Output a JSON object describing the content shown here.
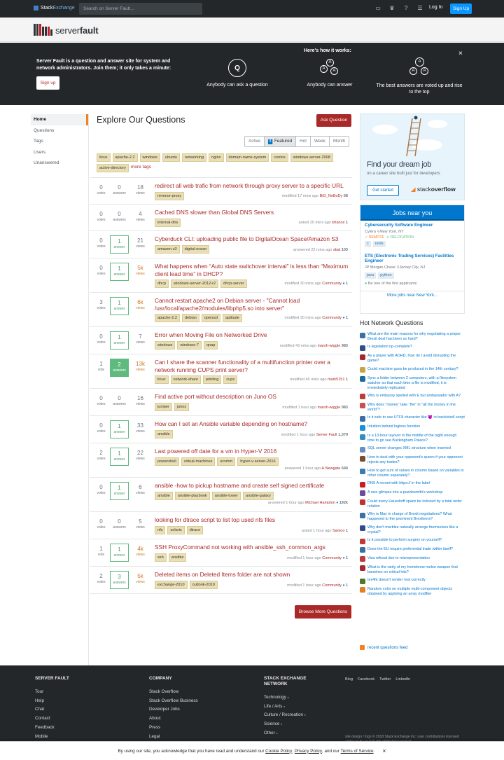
{
  "topbar": {
    "brand_stack": "Stack",
    "brand_exchange": "Exchange",
    "search_placeholder": "Search on Server Fault…",
    "login": "Log In",
    "signup": "Sign Up"
  },
  "site": {
    "name_light": "server",
    "name_bold": "fault"
  },
  "hero": {
    "text": "Server Fault is a question and answer site for system and network administrators. Join them; it only takes a minute:",
    "signup": "Sign up",
    "how": "Here's how it works:",
    "step1": "Anybody can ask a question",
    "step2": "Anybody can answer",
    "step3": "The best answers are voted up and rise to the top",
    "close": "×"
  },
  "nav": [
    "Home",
    "Questions",
    "Tags",
    "Users",
    "Unanswered"
  ],
  "main": {
    "title": "Explore Our Questions",
    "ask": "Ask Question",
    "filters": [
      "Active",
      "Featured",
      "Hot",
      "Week",
      "Month"
    ],
    "featured_count": "4",
    "tags": [
      "linux",
      "apache-2.2",
      "windows",
      "ubuntu",
      "networking",
      "nginx",
      "domain-name-system",
      "centos",
      "windows-server-2008",
      "active-directory"
    ],
    "more_tags": "more tags",
    "browse": "Browse More Questions"
  },
  "labels": {
    "votes": "votes",
    "vote": "vote",
    "answers": "answers",
    "answer": "answer",
    "views": "views"
  },
  "questions": [
    {
      "votes": "0",
      "vl": "votes",
      "answers": "0",
      "al": "answers",
      "views": "18",
      "title": "redirect all web trafic from network through proxy server to a specific URL",
      "tags": [
        "reverse-proxy"
      ],
      "meta_pre": "modified 17 mins ago",
      "user": "BiG_NoBoDy",
      "rep": "58",
      "h": 38
    },
    {
      "votes": "0",
      "vl": "votes",
      "answers": "0",
      "al": "answers",
      "views": "4",
      "title": "Cached DNS slower than Global DNS Servers",
      "tags": [
        "internal-dns"
      ],
      "meta_pre": "asked 20 mins ago",
      "user": "kfrance",
      "rep": "1",
      "h": 38
    },
    {
      "votes": "0",
      "vl": "votes",
      "answers": "1",
      "al": "answer",
      "views": "21",
      "title": "Cyberduck CLI: uploading public file to DigitalOcean Space/Amazon S3",
      "tags": [
        "amazon-s3",
        "digital-ocean"
      ],
      "meta_pre": "answered 22 mins ago",
      "user": "sbat",
      "rep": "103",
      "h": 39
    },
    {
      "votes": "0",
      "vl": "votes",
      "answers": "1",
      "al": "answer",
      "views": "5k",
      "title": "What happens when “Auto state switchover interval” is less than “Maximum client lead time” in DHCP?",
      "tags": [
        "dhcp",
        "windows-server-2012-r2",
        "dhcp-server"
      ],
      "meta_pre": "modified 30 mins ago",
      "user": "Community",
      "rep": "1",
      "diamond": true,
      "h": 49
    },
    {
      "votes": "3",
      "vl": "votes",
      "answers": "1",
      "al": "answer",
      "views": "6k",
      "title": "Cannot restart apache2 on Debian server - \"Cannot load /usr/local/apache2/modules/libphp5.so into server\"",
      "tags": [
        "apache-2.2",
        "debian",
        "openssl",
        "aptitude"
      ],
      "meta_pre": "modified 30 mins ago",
      "user": "Community",
      "rep": "1",
      "diamond": true,
      "h": 49
    },
    {
      "votes": "0",
      "vl": "votes",
      "answers": "1",
      "al": "answer",
      "views": "7",
      "title": "Error when Moving File on Networked Drive",
      "tags": [
        "windows",
        "windows-7",
        "qnap"
      ],
      "meta_pre": "modified 43 mins ago",
      "user": "marsh-wiggle",
      "rep": "983",
      "h": 39
    },
    {
      "votes": "1",
      "vl": "vote",
      "answers": "2",
      "al": "answers",
      "views": "13k",
      "title": "Can I share the scanner functionality of a multifunction printer over a network running CUPS print server?",
      "tags": [
        "linux",
        "network-share",
        "printing",
        "cups"
      ],
      "meta_pre": "modified 45 mins ago",
      "user": "mark5151",
      "rep": "1",
      "accepted": true,
      "h": 49
    },
    {
      "votes": "0",
      "vl": "votes",
      "answers": "0",
      "al": "answers",
      "views": "16",
      "title": "Find active port without description on Juno OS",
      "tags": [
        "juniper",
        "junos"
      ],
      "meta_pre": "modified 1 hour ago",
      "user": "marsh-wiggle",
      "rep": "983",
      "h": 39
    },
    {
      "votes": "0",
      "vl": "votes",
      "answers": "1",
      "al": "answer",
      "views": "33",
      "title": "How can I set an Ansible variable depending on hostname?",
      "tags": [
        "ansible"
      ],
      "meta_pre": "modified 1 hour ago",
      "user": "Server Fault",
      "rep": "1,379",
      "h": 39
    },
    {
      "votes": "2",
      "vl": "votes",
      "answers": "1",
      "al": "answer",
      "views": "22",
      "title": "Last powered off date for a vm in Hyper-V 2016",
      "tags": [
        "powershell",
        "virtual-machines",
        "scvmm",
        "hyper-v-server-2016"
      ],
      "meta_pre": "answered 1 hour ago",
      "user": "A.Newgate",
      "rep": "640",
      "h": 49
    },
    {
      "votes": "0",
      "vl": "votes",
      "answers": "1",
      "al": "answer",
      "views": "6",
      "title": "ansible -how to pickup hostname and create self signed certificate",
      "tags": [
        "ansible",
        "ansible-playbook",
        "ansible-tower",
        "ansible-galaxy"
      ],
      "meta_pre": "answered 1 hour ago",
      "user": "Michael Hampton",
      "rep": "192k",
      "diamond": true,
      "h": 49
    },
    {
      "votes": "0",
      "vl": "votes",
      "answers": "0",
      "al": "answers",
      "views": "5",
      "title": "looking for dtrace script to list top used nfs files",
      "tags": [
        "nfs",
        "solaris",
        "dtrace"
      ],
      "meta_pre": "asked 1 hour ago",
      "user": "Samoo",
      "rep": "1",
      "h": 39
    },
    {
      "votes": "1",
      "vl": "vote",
      "answers": "1",
      "al": "answer",
      "views": "4k",
      "title": "SSH ProxyCommand not working with ansible_ssh_common_args",
      "tags": [
        "ssh",
        "ansible"
      ],
      "meta_pre": "modified 1 hour ago",
      "user": "Community",
      "rep": "1",
      "diamond": true,
      "h": 39
    },
    {
      "votes": "2",
      "vl": "votes",
      "answers": "3",
      "al": "answers",
      "views": "5k",
      "title": "Deleted items on Deleted Items folder are not shown",
      "tags": [
        "exchange-2010",
        "outlook-2010"
      ],
      "meta_pre": "modified 1 hour ago",
      "user": "Community",
      "rep": "1",
      "diamond": true,
      "h": 39
    }
  ],
  "ad": {
    "title": "Find your dream job",
    "subtitle": "on a career site built just for developers",
    "button": "Get started",
    "brand_light": "stack",
    "brand_bold": "overflow"
  },
  "jobs": {
    "header": "Jobs near you",
    "items": [
      {
        "title": "Cybersecurity Software Engineer",
        "company": "Cylera",
        "loc": "New York, NY",
        "remote": "REMOTE",
        "reloc": "RELOCATION",
        "tags": [
          "c",
          "redis"
        ]
      },
      {
        "title": "ETS (Electronic Trading Services) Facilities Engineer",
        "company": "JP Morgan Chase",
        "loc": "Jersey City, NJ",
        "tags": [
          "java",
          "python"
        ],
        "benefit": "Be one of the first applicants"
      }
    ],
    "more": "More jobs near New York..."
  },
  "hnq": {
    "title": "Hot Network Questions",
    "items": [
      {
        "t": "What are the main reasons for why negotiating a proper Brexit deal has been so hard?",
        "c": "#3c6fa6"
      },
      {
        "t": "Is legislation np-complete?",
        "c": "#2d4e88"
      },
      {
        "t": "As a player with ADHD, how do I avoid disrupting the game?",
        "c": "#a8272c"
      },
      {
        "t": "Could machine guns be produced in the 14th century?",
        "c": "#c9a445"
      },
      {
        "t": "Sync a folder between 2 computers, with a filesystem watcher so that each time a file is modified, it is immediately replicated",
        "c": "#1d6b9c"
      },
      {
        "t": "Why is embassy spelled with E but ambassador with A?",
        "c": "#c03a3a"
      },
      {
        "t": "Why does \"money\" take \"the\" in \"all the money in the world\"?",
        "c": "#d04d4d"
      },
      {
        "t": "Is it safe to use UTF8 character like 😈 in bash/shell script",
        "c": "#3b6ea6"
      },
      {
        "t": "Intuition behind logloss function",
        "c": "#1d8fd8"
      },
      {
        "t": "Is a 13-hour layover in the middle of the night enough time to go see Buckingham Palace?",
        "c": "#2f8cc4"
      },
      {
        "t": "SQL server changes XML structure when inserted",
        "c": "#6a8fbf"
      },
      {
        "t": "How to deal with your opponent's queen if your opponent rejects any trades?",
        "c": "#7a4e2a"
      },
      {
        "t": "How to get sum of values in column based on variables in other column separately?",
        "c": "#3a7bb0"
      },
      {
        "t": "DNS A record with https:// in the label",
        "c": "#c81d25"
      },
      {
        "t": "A rare glimpse into a puzzlesmith's workshop",
        "c": "#6b4b9a"
      },
      {
        "t": "Could every Hausdorff space be induced by a total order relation",
        "c": "#c52f2f"
      },
      {
        "t": "Why is May in charge of Brexit negotiations? What happened to the prominent Brexiteers?",
        "c": "#3c6fa6"
      },
      {
        "t": "Why don't marbles naturally arrange themselves like a crystal?",
        "c": "#2d4e88"
      },
      {
        "t": "Is it possible to perform surgery on yourself?",
        "c": "#c03a3a"
      },
      {
        "t": "Does the EU require preferential trade within itself?",
        "c": "#3c6fa6"
      },
      {
        "t": "Visa refusal due to misrepresentation",
        "c": "#c03a3a"
      },
      {
        "t": "What is the rarity of my homebrew melee weapon that banishes on critical hits?",
        "c": "#a8272c"
      },
      {
        "t": "tex4ht doesn't render \\not correctly",
        "c": "#4a7a2a"
      },
      {
        "t": "Random color on multiple multi-component objects obtained by applying an array modifier",
        "c": "#e67e22"
      }
    ],
    "feed": "recent questions feed"
  },
  "footer": {
    "col1": {
      "title": "SERVER FAULT",
      "items": [
        "Tour",
        "Help",
        "Chat",
        "Contact",
        "Feedback",
        "Mobile"
      ]
    },
    "col2": {
      "title": "COMPANY",
      "items": [
        "Stack Overflow",
        "Stack Overflow Business",
        "Developer Jobs",
        "About",
        "Press",
        "Legal"
      ]
    },
    "col3": {
      "title": "STACK EXCHANGE NETWORK",
      "items": [
        "Technology",
        "Life / Arts",
        "Culture / Recreation",
        "Science",
        "Other"
      ]
    },
    "links": [
      "Blog",
      "Facebook",
      "Twitter",
      "LinkedIn"
    ],
    "copy": "site design / logo © 2018 Stack Exchange Inc; user contributions licensed under cc by-sa 3.0 with attribution required."
  },
  "cookie": {
    "pre": "By using our site, you acknowledge that you have read and understand our",
    "cp": "Cookie Policy",
    "pp": "Privacy Policy",
    "and": ", and our",
    "tos": "Terms of Service",
    "close": "×"
  }
}
